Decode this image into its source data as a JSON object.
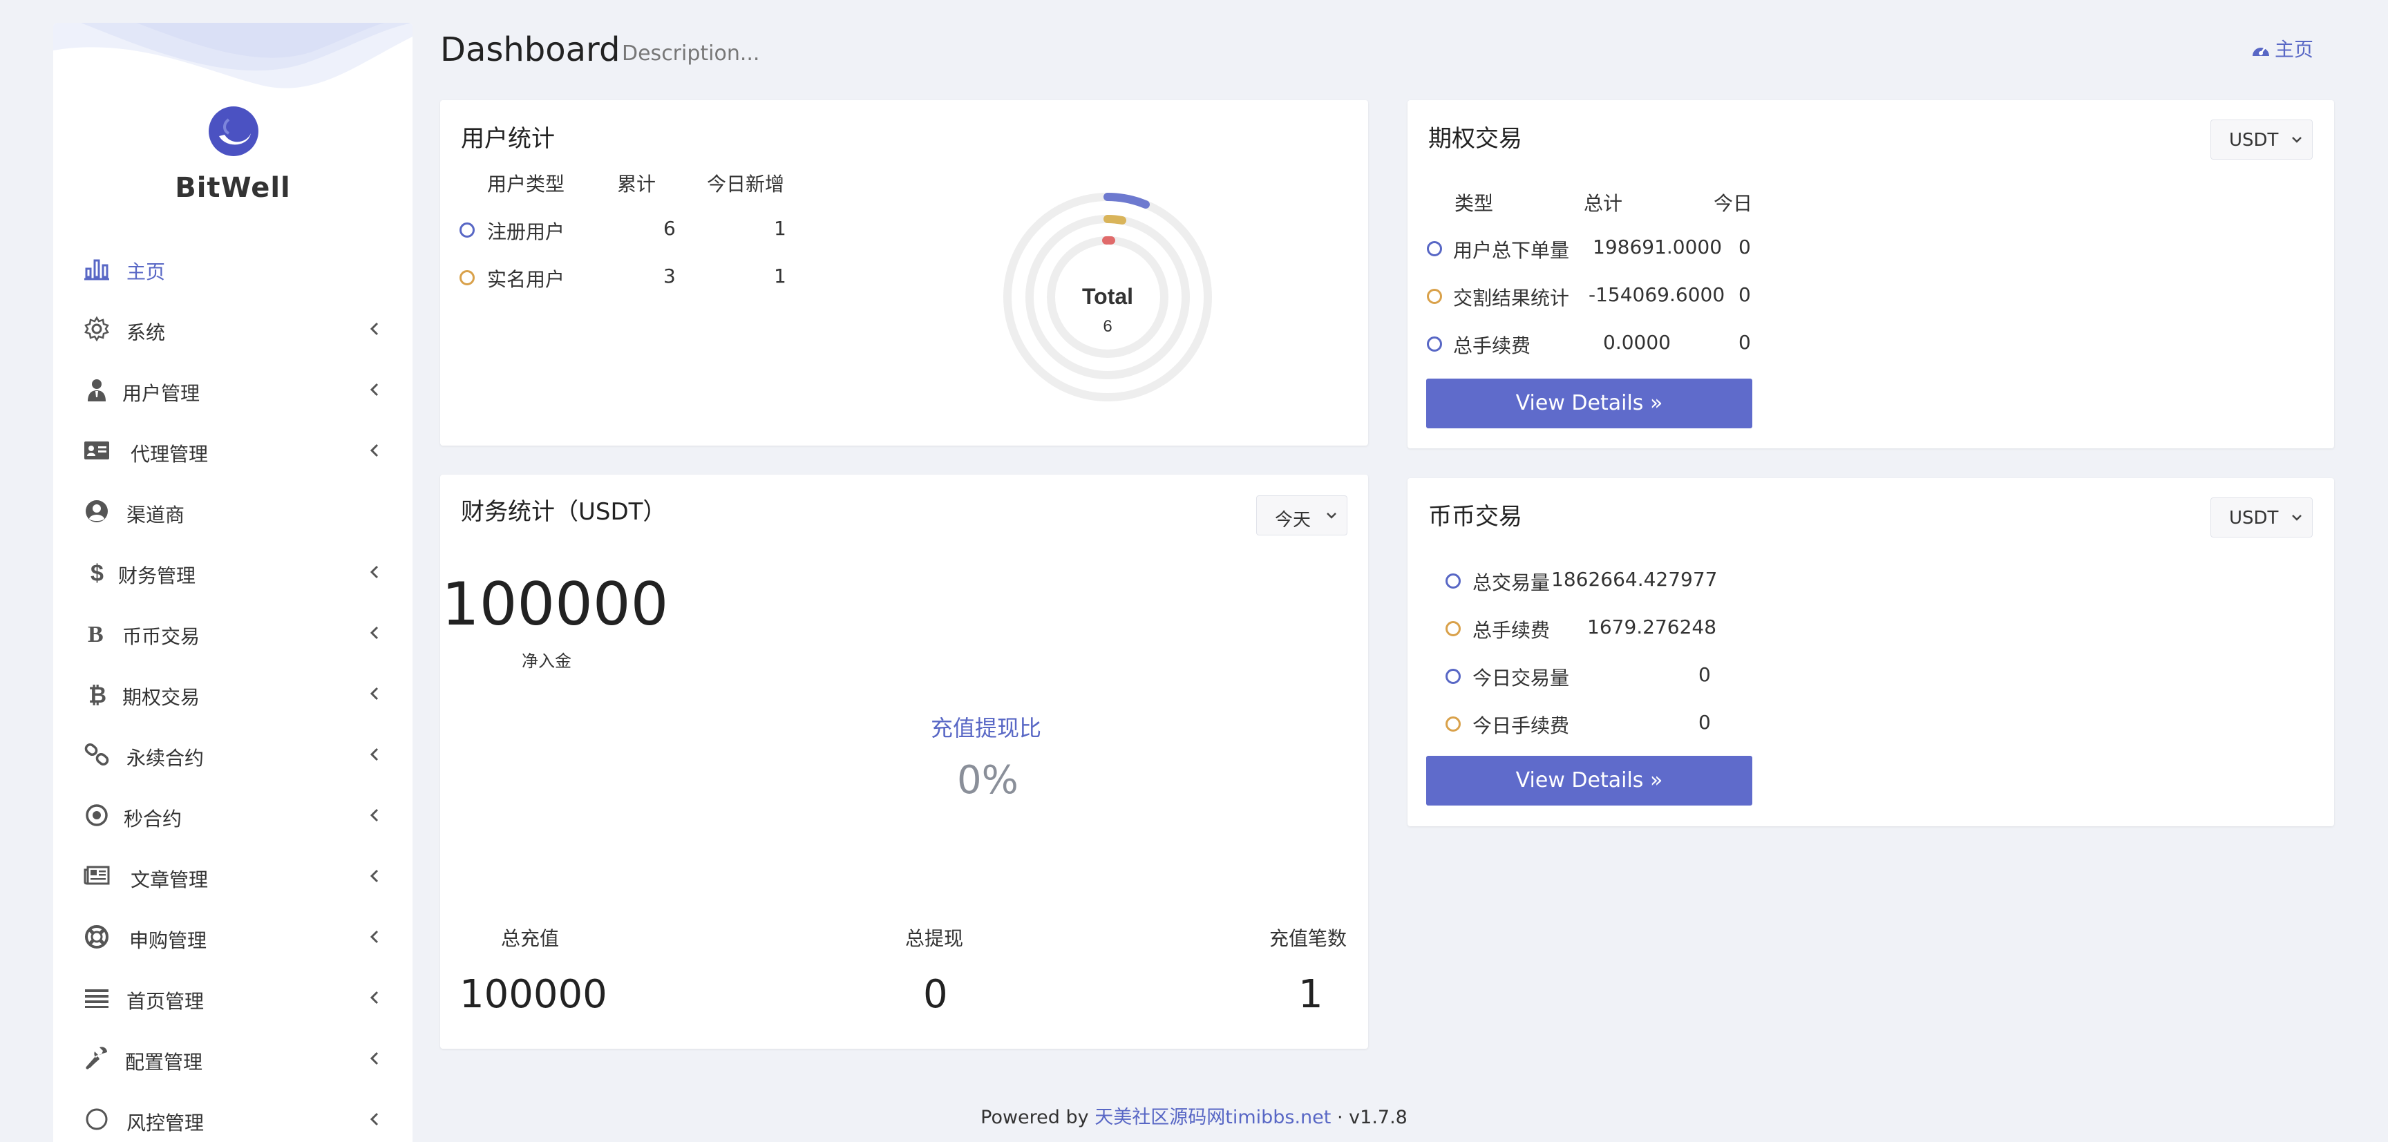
{
  "brand": {
    "name": "BitWell"
  },
  "sidebar": {
    "items": [
      {
        "label": "主页",
        "icon": "bar-chart-icon",
        "active": true,
        "chevron": false
      },
      {
        "label": "系统",
        "icon": "gear-icon",
        "chevron": true
      },
      {
        "label": "用户管理",
        "icon": "user-tie-icon",
        "chevron": true
      },
      {
        "label": "代理管理",
        "icon": "id-card-icon",
        "chevron": true
      },
      {
        "label": "渠道商",
        "icon": "user-circle-icon",
        "chevron": false
      },
      {
        "label": "财务管理",
        "icon": "dollar-icon",
        "chevron": true
      },
      {
        "label": "币币交易",
        "icon": "bold-b-icon",
        "chevron": true
      },
      {
        "label": "期权交易",
        "icon": "bitcoin-icon",
        "chevron": true
      },
      {
        "label": "永续合约",
        "icon": "link-icon",
        "chevron": true
      },
      {
        "label": "秒合约",
        "icon": "dot-circle-icon",
        "chevron": true
      },
      {
        "label": "文章管理",
        "icon": "newspaper-icon",
        "chevron": true
      },
      {
        "label": "申购管理",
        "icon": "life-ring-icon",
        "chevron": true
      },
      {
        "label": "首页管理",
        "icon": "list-icon",
        "chevron": true
      },
      {
        "label": "配置管理",
        "icon": "wrench-icon",
        "chevron": true
      },
      {
        "label": "风控管理",
        "icon": "circle-icon",
        "chevron": true
      }
    ]
  },
  "header": {
    "title": "Dashboard",
    "description": "Description...",
    "breadcrumb": "主页"
  },
  "user_stats": {
    "title": "用户统计",
    "columns": [
      "用户类型",
      "累计",
      "今日新增"
    ],
    "rows": [
      {
        "type": "注册用户",
        "total": "6",
        "today": "1"
      },
      {
        "type": "实名用户",
        "total": "3",
        "today": "1"
      }
    ],
    "ring": {
      "label": "Total",
      "value": "6"
    }
  },
  "options_trade": {
    "title": "期权交易",
    "currency": "USDT",
    "columns": [
      "类型",
      "总计",
      "今日"
    ],
    "rows": [
      {
        "type": "用户总下单量",
        "total": "198691.0000",
        "today": "0"
      },
      {
        "type": "交割结果统计",
        "total": "-154069.6000",
        "today": "0"
      },
      {
        "type": "总手续费",
        "total": "0.0000",
        "today": "0"
      }
    ],
    "button": "View Details"
  },
  "finance": {
    "title": "财务统计（USDT）",
    "period": "今天",
    "net": "100000",
    "net_label": "净入金",
    "ratio_label": "充值提现比",
    "ratio_value": "0%",
    "totals": [
      {
        "label": "总充值",
        "value": "100000"
      },
      {
        "label": "总提现",
        "value": "0"
      },
      {
        "label": "充值笔数",
        "value": "1"
      }
    ]
  },
  "coin_trade": {
    "title": "币币交易",
    "currency": "USDT",
    "rows": [
      {
        "label": "总交易量",
        "value": "1862664.427977"
      },
      {
        "label": "总手续费",
        "value": "1679.276248"
      },
      {
        "label": "今日交易量",
        "value": "0"
      },
      {
        "label": "今日手续费",
        "value": "0"
      }
    ],
    "button": "View Details"
  },
  "footer": {
    "prefix": "Powered by",
    "link": "天美社区源码网timibbs.net",
    "sep": "·",
    "version": "v1.7.8"
  },
  "colors": {
    "accent": "#5867c5",
    "button": "#5f6bcb",
    "yellow": "#d9a14a",
    "red": "#e06a6a",
    "background": "#f0f2f7"
  }
}
